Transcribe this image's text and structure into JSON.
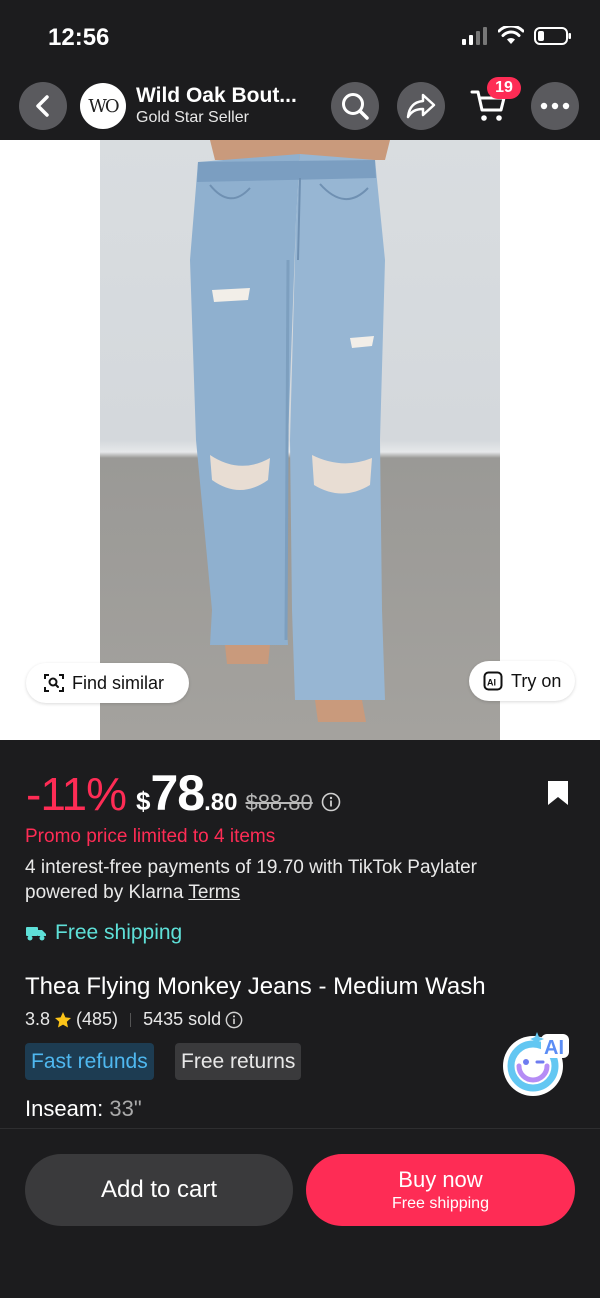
{
  "status": {
    "time": "12:56"
  },
  "header": {
    "store_logo_text": "WO",
    "store_name": "Wild Oak Bout...",
    "store_badge": "Gold Star Seller",
    "cart_count": "19"
  },
  "image": {
    "find_similar_label": "Find similar",
    "try_on_label": "Try on",
    "try_on_icon_text": "AI"
  },
  "price": {
    "discount": "-11%",
    "currency": "$",
    "integer": "78",
    "decimal": ".80",
    "original": "$88.80"
  },
  "promo": {
    "text": "Promo price limited to 4 items",
    "paylater": "4 interest-free payments of 19.70 with  TikTok Paylater powered by Klarna",
    "terms": "Terms"
  },
  "shipping": {
    "label": "Free shipping"
  },
  "product": {
    "title": "Thea Flying Monkey Jeans - Medium Wash",
    "rating": "3.8",
    "review_count": "(485)",
    "sold": "5435 sold"
  },
  "tags": {
    "fast_refunds": "Fast refunds",
    "free_returns": "Free returns"
  },
  "ai_badge": {
    "label": "AI"
  },
  "inseam": {
    "label": "Inseam:",
    "value": "33\""
  },
  "actions": {
    "add_to_cart": "Add to cart",
    "buy_now": "Buy now",
    "buy_now_sub": "Free shipping"
  },
  "colors": {
    "accent": "#fe2c55",
    "shipping": "#5ee0d8",
    "fast_refund_text": "#4fb8f0",
    "background": "#1c1c1e"
  }
}
